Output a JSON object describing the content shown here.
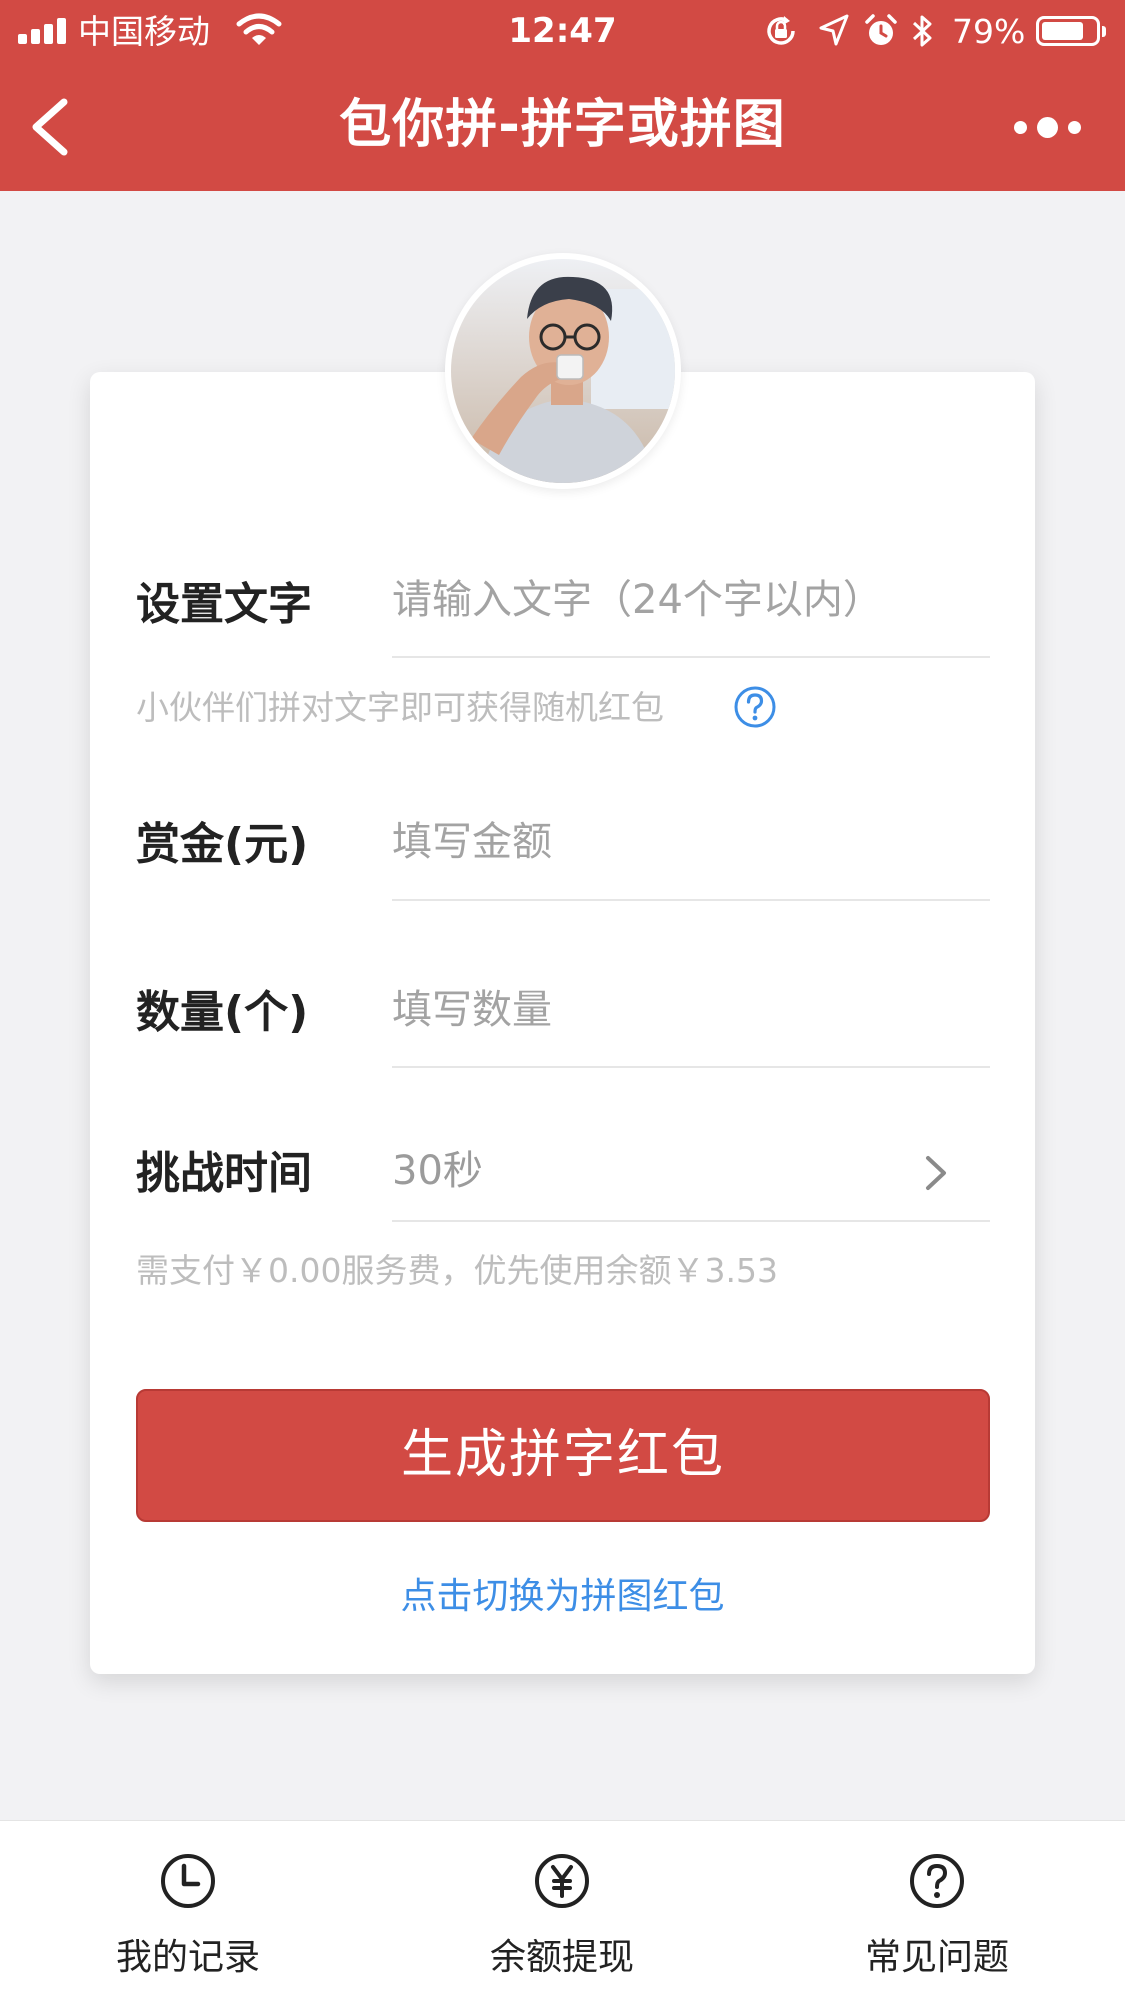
{
  "status_bar": {
    "carrier": "中国移动",
    "time": "12:47",
    "battery_percent": "79%",
    "battery_level": 0.79
  },
  "nav": {
    "title": "包你拼-拼字或拼图",
    "back_icon": "chevron-left-icon",
    "more_icon": "more-dots-icon"
  },
  "form": {
    "text_label": "设置文字",
    "text_placeholder": "请输入文字（24个字以内）",
    "text_hint": "小伙伴们拼对文字即可获得随机红包",
    "reward_label": "赏金(元)",
    "reward_placeholder": "填写金额",
    "count_label": "数量(个)",
    "count_placeholder": "填写数量",
    "time_label": "挑战时间",
    "time_value": "30秒",
    "fee_hint": "需支付￥0.00服务费，优先使用余额￥3.53"
  },
  "actions": {
    "generate_button": "生成拼字红包",
    "switch_link": "点击切换为拼图红包"
  },
  "tabs": [
    {
      "label": "我的记录",
      "icon": "clock-icon"
    },
    {
      "label": "余额提现",
      "icon": "yuan-icon"
    },
    {
      "label": "常见问题",
      "icon": "question-icon"
    }
  ],
  "colors": {
    "brand_red": "#d24a44",
    "link_blue": "#3d8ee6"
  }
}
